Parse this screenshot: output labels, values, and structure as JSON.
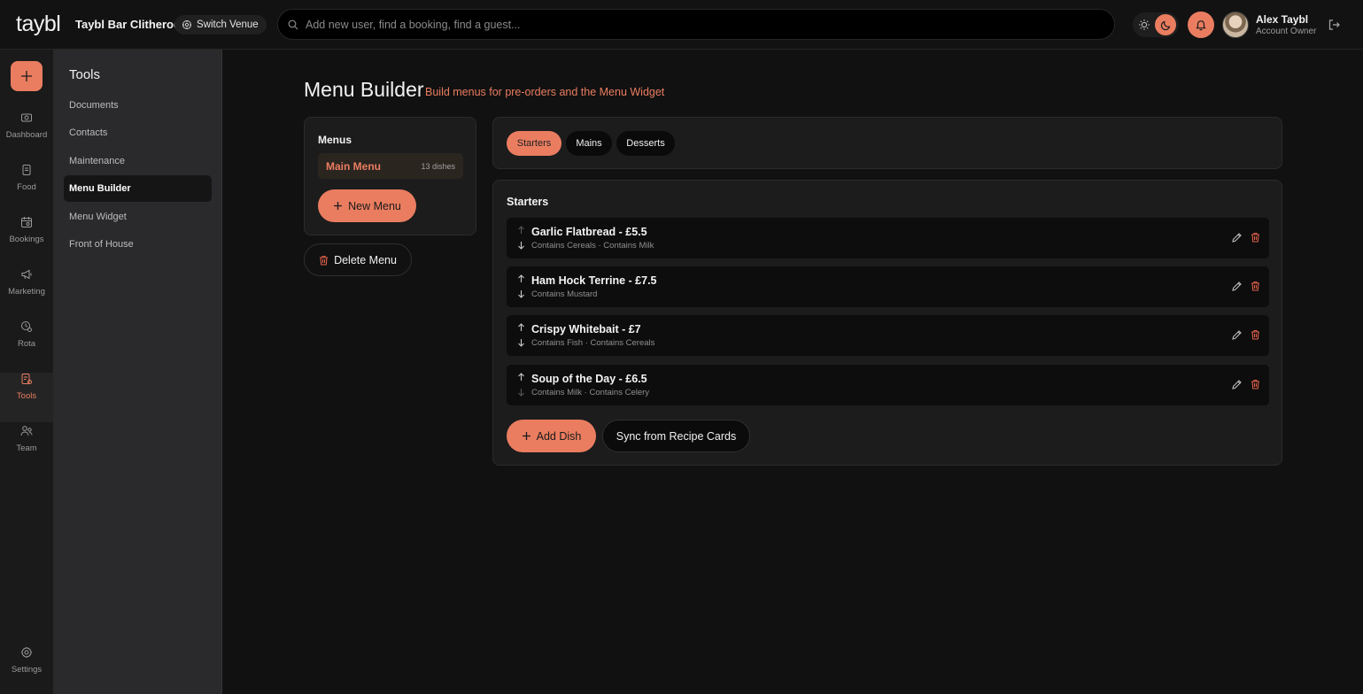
{
  "header": {
    "logo": "taybl",
    "venue": "Taybl Bar Clitheroe",
    "switch_venue_label": "Switch Venue",
    "search_placeholder": "Add new user, find a booking, find a guest...",
    "user_name": "Alex Taybl",
    "user_role": "Account Owner",
    "theme": "dark"
  },
  "rail": {
    "items": [
      {
        "label": "Dashboard",
        "icon": "dashboard-icon"
      },
      {
        "label": "Food",
        "icon": "food-icon"
      },
      {
        "label": "Bookings",
        "icon": "bookings-icon"
      },
      {
        "label": "Marketing",
        "icon": "megaphone-icon"
      },
      {
        "label": "Rota",
        "icon": "rota-icon"
      },
      {
        "label": "Tools",
        "icon": "tools-icon",
        "active": true
      },
      {
        "label": "Team",
        "icon": "team-icon"
      }
    ],
    "settings_label": "Settings"
  },
  "tools": {
    "title": "Tools",
    "items": [
      {
        "label": "Documents"
      },
      {
        "label": "Contacts"
      },
      {
        "label": "Maintenance"
      },
      {
        "label": "Menu Builder",
        "active": true
      },
      {
        "label": "Menu Widget"
      },
      {
        "label": "Front of House"
      }
    ]
  },
  "page": {
    "title": "Menu Builder",
    "subtitle": "Build menus for pre-orders and the Menu Widget"
  },
  "menus": {
    "heading": "Menus",
    "items": [
      {
        "name": "Main Menu",
        "count": "13 dishes"
      }
    ],
    "new_menu_label": "New Menu",
    "delete_menu_label": "Delete Menu"
  },
  "tabs": [
    {
      "label": "Starters",
      "active": true
    },
    {
      "label": "Mains"
    },
    {
      "label": "Desserts"
    }
  ],
  "section": {
    "heading": "Starters",
    "dishes": [
      {
        "name": "Garlic Flatbread - £5.5",
        "allergens": "Contains Cereals · Contains Milk"
      },
      {
        "name": "Ham Hock Terrine - £7.5",
        "allergens": "Contains Mustard"
      },
      {
        "name": "Crispy Whitebait - £7",
        "allergens": "Contains Fish · Contains Cereals"
      },
      {
        "name": "Soup of the Day - £6.5",
        "allergens": "Contains Milk · Contains Celery"
      }
    ],
    "add_dish_label": "Add Dish",
    "sync_label": "Sync from Recipe Cards"
  },
  "colors": {
    "accent": "#ea7d60",
    "background": "#111111",
    "card": "#1c1c1c",
    "sidebar": "#2a2a2d"
  }
}
